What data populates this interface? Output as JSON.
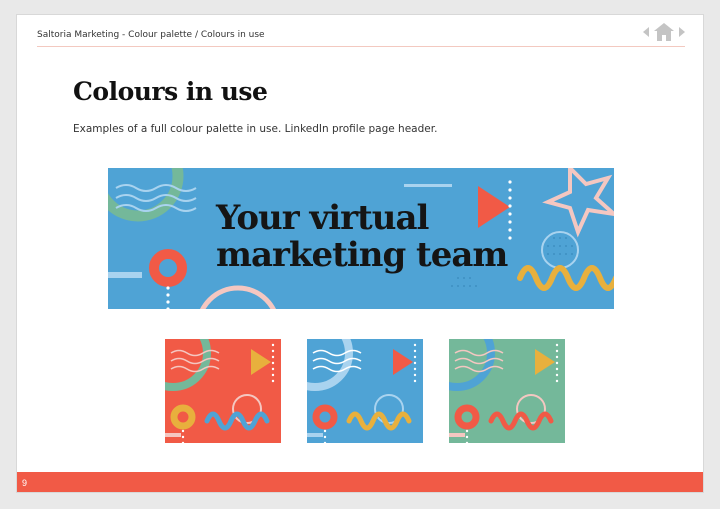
{
  "breadcrumb": "Saltoria Marketing - Colour palette / Colours in use",
  "nav": {
    "prev_icon": "arrow-left-icon",
    "home_icon": "home-icon",
    "next_icon": "arrow-right-icon"
  },
  "title": "Colours in use",
  "subtitle": "Examples of a full colour palette in use. LinkedIn profile page header.",
  "banner": {
    "line1": "Your virtual",
    "line2": "marketing team"
  },
  "thumbnails": [
    {
      "background": "#f15a46"
    },
    {
      "background": "#4fa3d5"
    },
    {
      "background": "#74b89a"
    }
  ],
  "page_number": "9",
  "colors": {
    "coral": "#f15a46",
    "sky_blue": "#4fa3d5",
    "sage_green": "#74b89a",
    "mustard": "#e8b03d",
    "pale_pink": "#f4c7c1",
    "light_blue": "#a9d3ef"
  }
}
